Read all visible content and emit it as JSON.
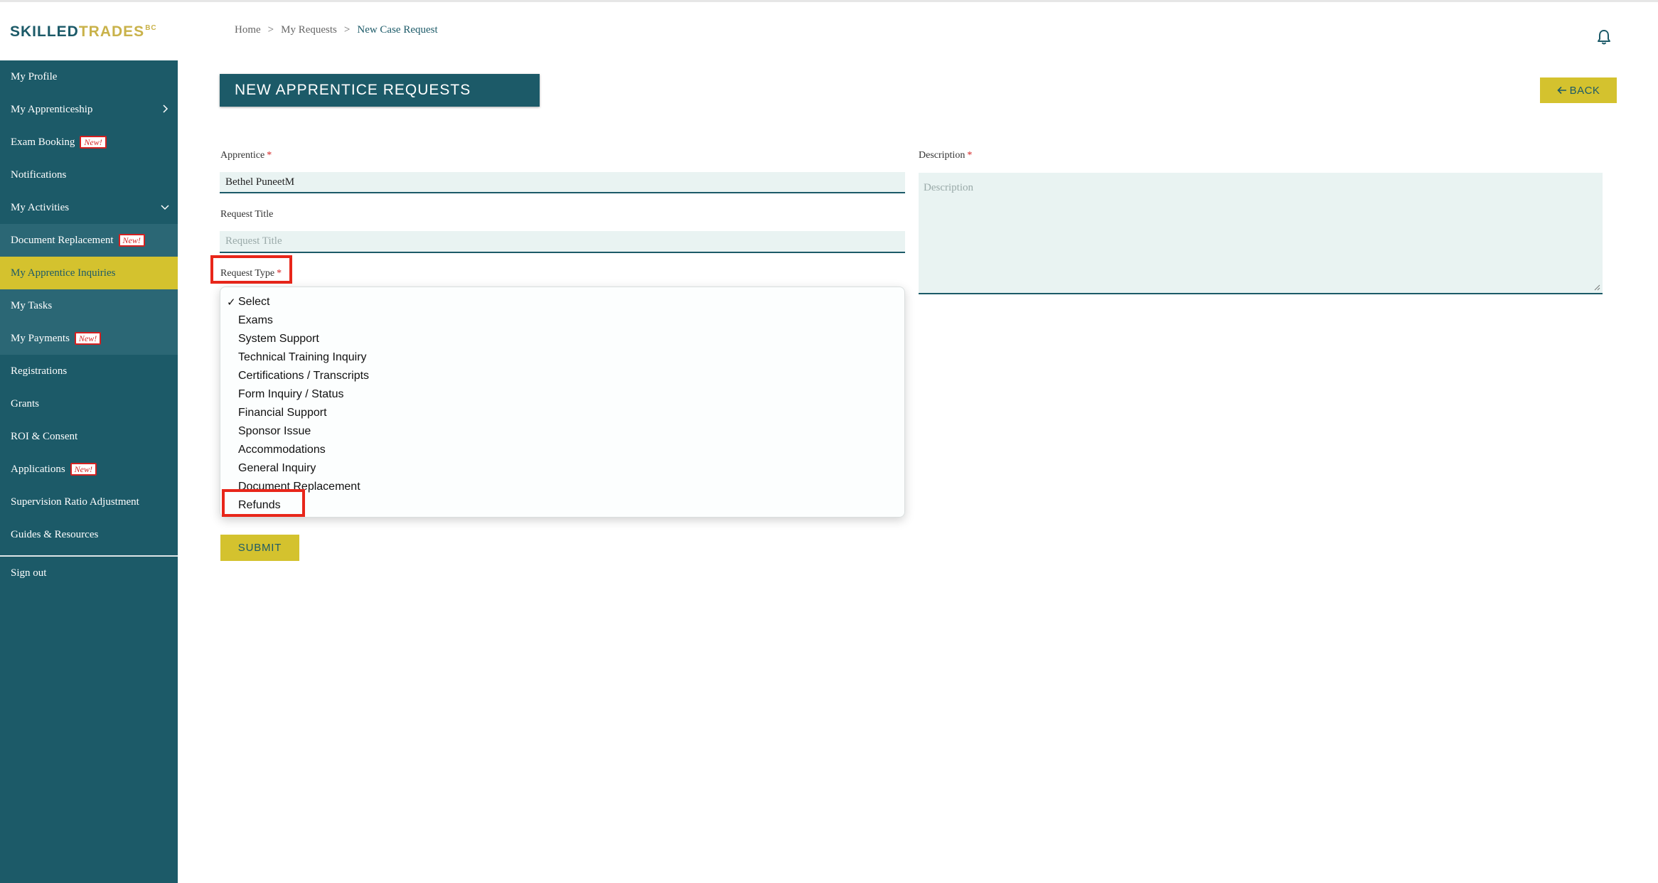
{
  "logo": {
    "part1": "SKILLED",
    "part2": "TRADES",
    "suffix": "BC"
  },
  "sidebar": {
    "items": [
      {
        "label": "My Profile",
        "badge": ""
      },
      {
        "label": "My Apprenticeship",
        "badge": "",
        "chevron": "chevron-right-icon"
      },
      {
        "label": "Exam Booking",
        "badge": "New!"
      },
      {
        "label": "Notifications",
        "badge": ""
      },
      {
        "label": "My Activities",
        "badge": "",
        "chevron": "chevron-down-icon"
      },
      {
        "label": "Document Replacement",
        "badge": "New!"
      },
      {
        "label": "My Apprentice Inquiries",
        "badge": "",
        "active": true
      },
      {
        "label": "My Tasks",
        "badge": ""
      },
      {
        "label": "My Payments",
        "badge": "New!"
      },
      {
        "label": "Registrations",
        "badge": ""
      },
      {
        "label": "Grants",
        "badge": ""
      },
      {
        "label": "ROI & Consent",
        "badge": ""
      },
      {
        "label": "Applications",
        "badge": "New!"
      },
      {
        "label": "Supervision Ratio Adjustment",
        "badge": ""
      },
      {
        "label": "Guides & Resources",
        "badge": ""
      },
      {
        "label": "Sign out",
        "badge": ""
      }
    ]
  },
  "breadcrumb": {
    "home": "Home",
    "sep": ">",
    "requests": "My Requests",
    "current": "New Case Request"
  },
  "page": {
    "title": "NEW APPRENTICE REQUESTS",
    "back_label": "BACK",
    "back_icon": "arrow-left-icon"
  },
  "form": {
    "apprentice_label": "Apprentice",
    "apprentice_value": "Bethel PuneetM",
    "request_title_label": "Request Title",
    "request_title_placeholder": "Request Title",
    "request_type_label": "Request Type",
    "required_mark": "*",
    "description_label": "Description",
    "description_placeholder": "Description",
    "submit_label": "SUBMIT"
  },
  "dropdown": {
    "check_mark": "✓",
    "selected_index": 0,
    "options": [
      "Select",
      "Exams",
      "System Support",
      "Technical Training Inquiry",
      "Certifications / Transcripts",
      "Form Inquiry / Status",
      "Financial Support",
      "Sponsor Issue",
      "Accommodations",
      "General Inquiry",
      "Document Replacement",
      "Refunds"
    ]
  },
  "colors": {
    "primary": "#1c5a68",
    "accent": "#d4c22e",
    "highlight": "#e8261a",
    "field_bg": "#e9f3f2"
  }
}
